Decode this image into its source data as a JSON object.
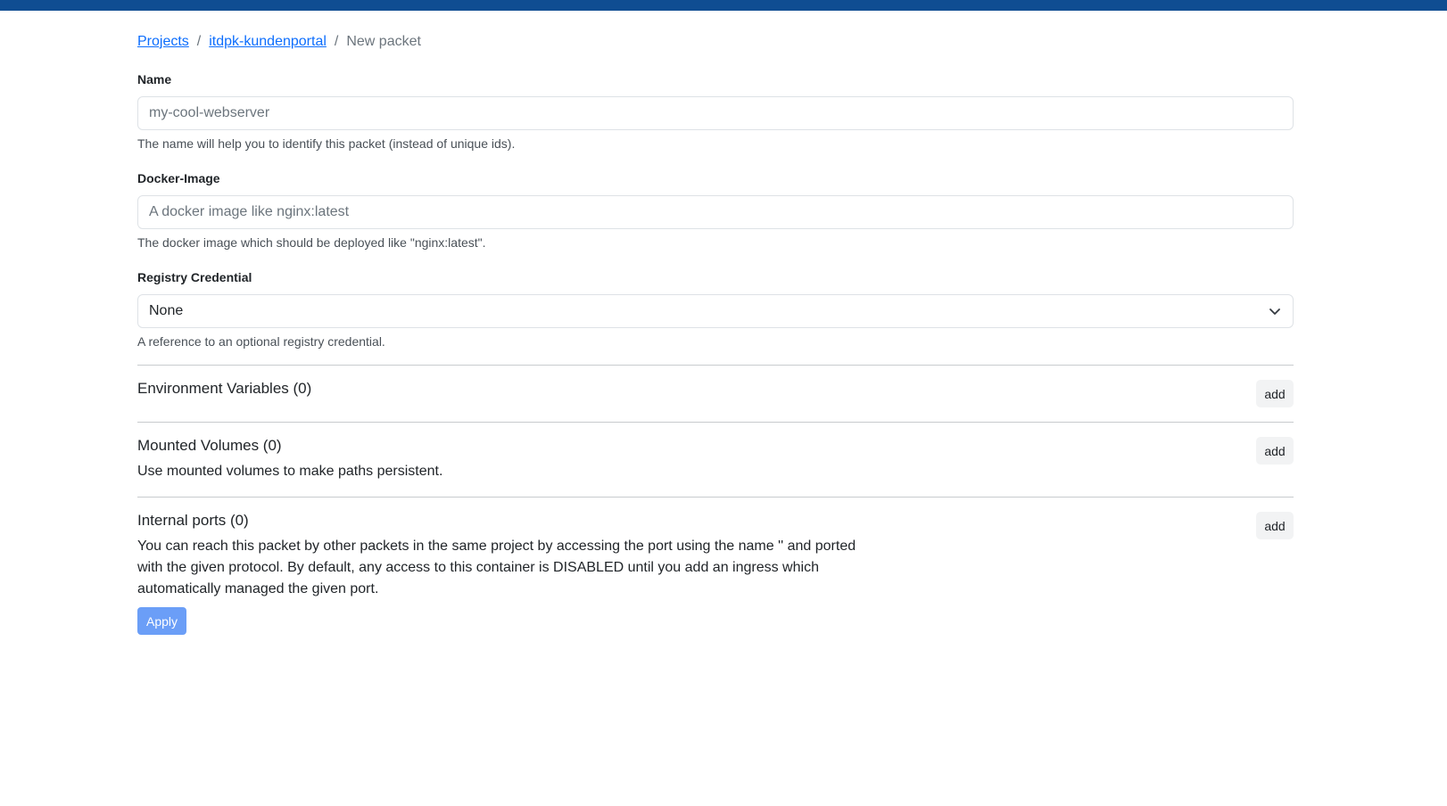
{
  "colors": {
    "topbar": "#0f4d92",
    "link": "#0d6efd",
    "apply_button": "#6b9ef7"
  },
  "breadcrumb": {
    "items": [
      "Projects",
      "itdpk-kundenportal"
    ],
    "current": "New packet",
    "separator": "/"
  },
  "form": {
    "name": {
      "label": "Name",
      "placeholder": "my-cool-webserver",
      "value": "",
      "help": "The name will help you to identify this packet (instead of unique ids)."
    },
    "docker_image": {
      "label": "Docker-Image",
      "placeholder": "A docker image like nginx:latest",
      "value": "",
      "help": "The docker image which should be deployed like \"nginx:latest\"."
    },
    "registry_credential": {
      "label": "Registry Credential",
      "selected": "None",
      "help": "A reference to an optional registry credential."
    }
  },
  "sections": {
    "env": {
      "title": "Environment Variables (0)",
      "add_label": "add"
    },
    "volumes": {
      "title": "Mounted Volumes (0)",
      "description": "Use mounted volumes to make paths persistent.",
      "add_label": "add"
    },
    "ports": {
      "title": "Internal ports (0)",
      "description_lines": [
        "You can reach this packet by other packets in the same project by accessing the port using the name '' and ported",
        "with the given protocol. By default, any access to this container is DISABLED until you add an ingress which",
        "automatically managed the given port."
      ],
      "add_label": "add"
    }
  },
  "actions": {
    "apply_label": "Apply"
  },
  "icons": {
    "select_chevron": "chevron-down-icon"
  }
}
